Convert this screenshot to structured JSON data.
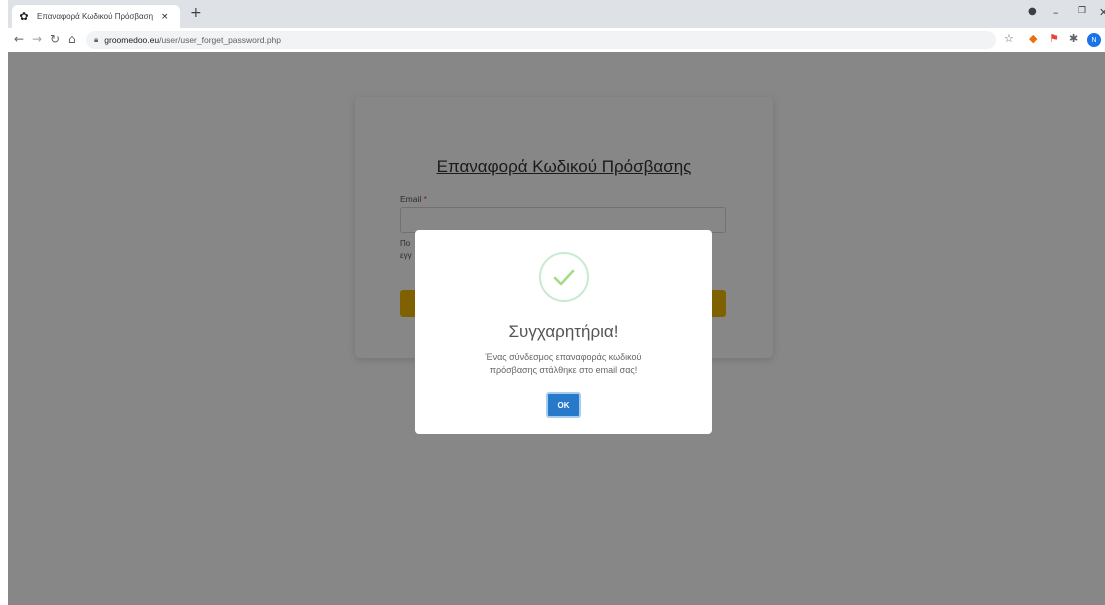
{
  "browser": {
    "tab_title": "Επαναφορά Κωδικού Πρόσβαση",
    "tab_close": "×",
    "new_tab": "+",
    "url_host": "groomedoo.eu",
    "url_path": "/user/user_forget_password.php",
    "icons": {
      "favicon": "paw-icon",
      "back": "back-arrow-icon",
      "forward": "forward-arrow-icon",
      "reload": "reload-icon",
      "home": "home-icon",
      "lock": "lock-icon",
      "bookmark": "star-icon",
      "profile_initial": "N"
    }
  },
  "form": {
    "title": "Επαναφορά Κωδικού Πρόσβασης",
    "email_label": "Email",
    "required_mark": "*",
    "hint_line1": "Πο",
    "hint_line2": "εγγ"
  },
  "dialog": {
    "title": "Συγχαρητήρια!",
    "message": "Ένας σύνδεσμος επαναφοράς κωδικού πρόσβασης στάλθηκε στο email σας!",
    "ok_label": "OK",
    "icon": "success-check-icon",
    "accent_color": "#a5dc86",
    "button_color": "#2779c9"
  },
  "colors": {
    "submit_button": "#f2b705"
  }
}
